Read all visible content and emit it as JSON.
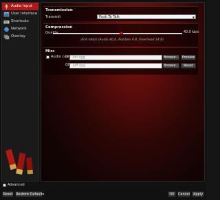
{
  "sidebar": {
    "items": [
      {
        "label": "Audio Input",
        "icon": "microphone-icon",
        "active": true
      },
      {
        "label": "User Interface",
        "icon": "window-icon",
        "active": false
      },
      {
        "label": "Shortcuts",
        "icon": "keyboard-icon",
        "active": false
      },
      {
        "label": "Network",
        "icon": "network-icon",
        "active": false
      },
      {
        "label": "Overlay",
        "icon": "overlay-icon",
        "active": false
      }
    ]
  },
  "transmission": {
    "title": "Transmission",
    "transmit_label": "Transmit",
    "transmit_value": "Push To Talk"
  },
  "compression": {
    "title": "Compression",
    "quality_label": "Quality",
    "quality_value": "40.0 kb/s",
    "quality_fraction": 0.53,
    "info": "39.6 kbit/s (Audio 40.0, Position 4.8, Overhead 14.8)"
  },
  "misc": {
    "title": "Misc",
    "audio_cue_label": "Audio cue",
    "audio_cue_checked": false,
    "on_label": "On",
    "on_value": ":/on.ogg",
    "off_label": "Off",
    "off_value": ":/off.ogg",
    "browse_label": "Browse...",
    "preview_label": "Preview",
    "reset_label": "Reset"
  },
  "footer": {
    "advanced_label": "Advanced",
    "advanced_checked": false,
    "reset_label": "Reset",
    "restore_defaults_label": "Restore Defaults",
    "ok_label": "OK",
    "cancel_label": "Cancel",
    "apply_label": "Apply"
  },
  "colors": {
    "accent": "#b01818",
    "background": "#111111"
  }
}
